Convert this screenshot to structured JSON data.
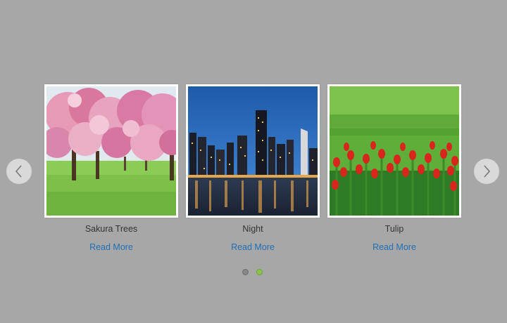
{
  "carousel": {
    "slides": [
      {
        "title": "Sakura Trees",
        "link": "Read More",
        "image": "sakura-trees-photo"
      },
      {
        "title": "Night",
        "link": "Read More",
        "image": "city-night-skyline-photo"
      },
      {
        "title": "Tulip",
        "link": "Read More",
        "image": "red-tulips-field-photo"
      }
    ],
    "prev_icon": "chevron-left-icon",
    "next_icon": "chevron-right-icon",
    "pagination": {
      "total": 2,
      "active": 2
    },
    "colors": {
      "background": "#a7a7a7",
      "link": "#1f6fb5",
      "caption": "#333333",
      "arrow_bg": "#d9d9d9",
      "dot_inactive": "#888888",
      "dot_active": "#8bc34a"
    }
  }
}
